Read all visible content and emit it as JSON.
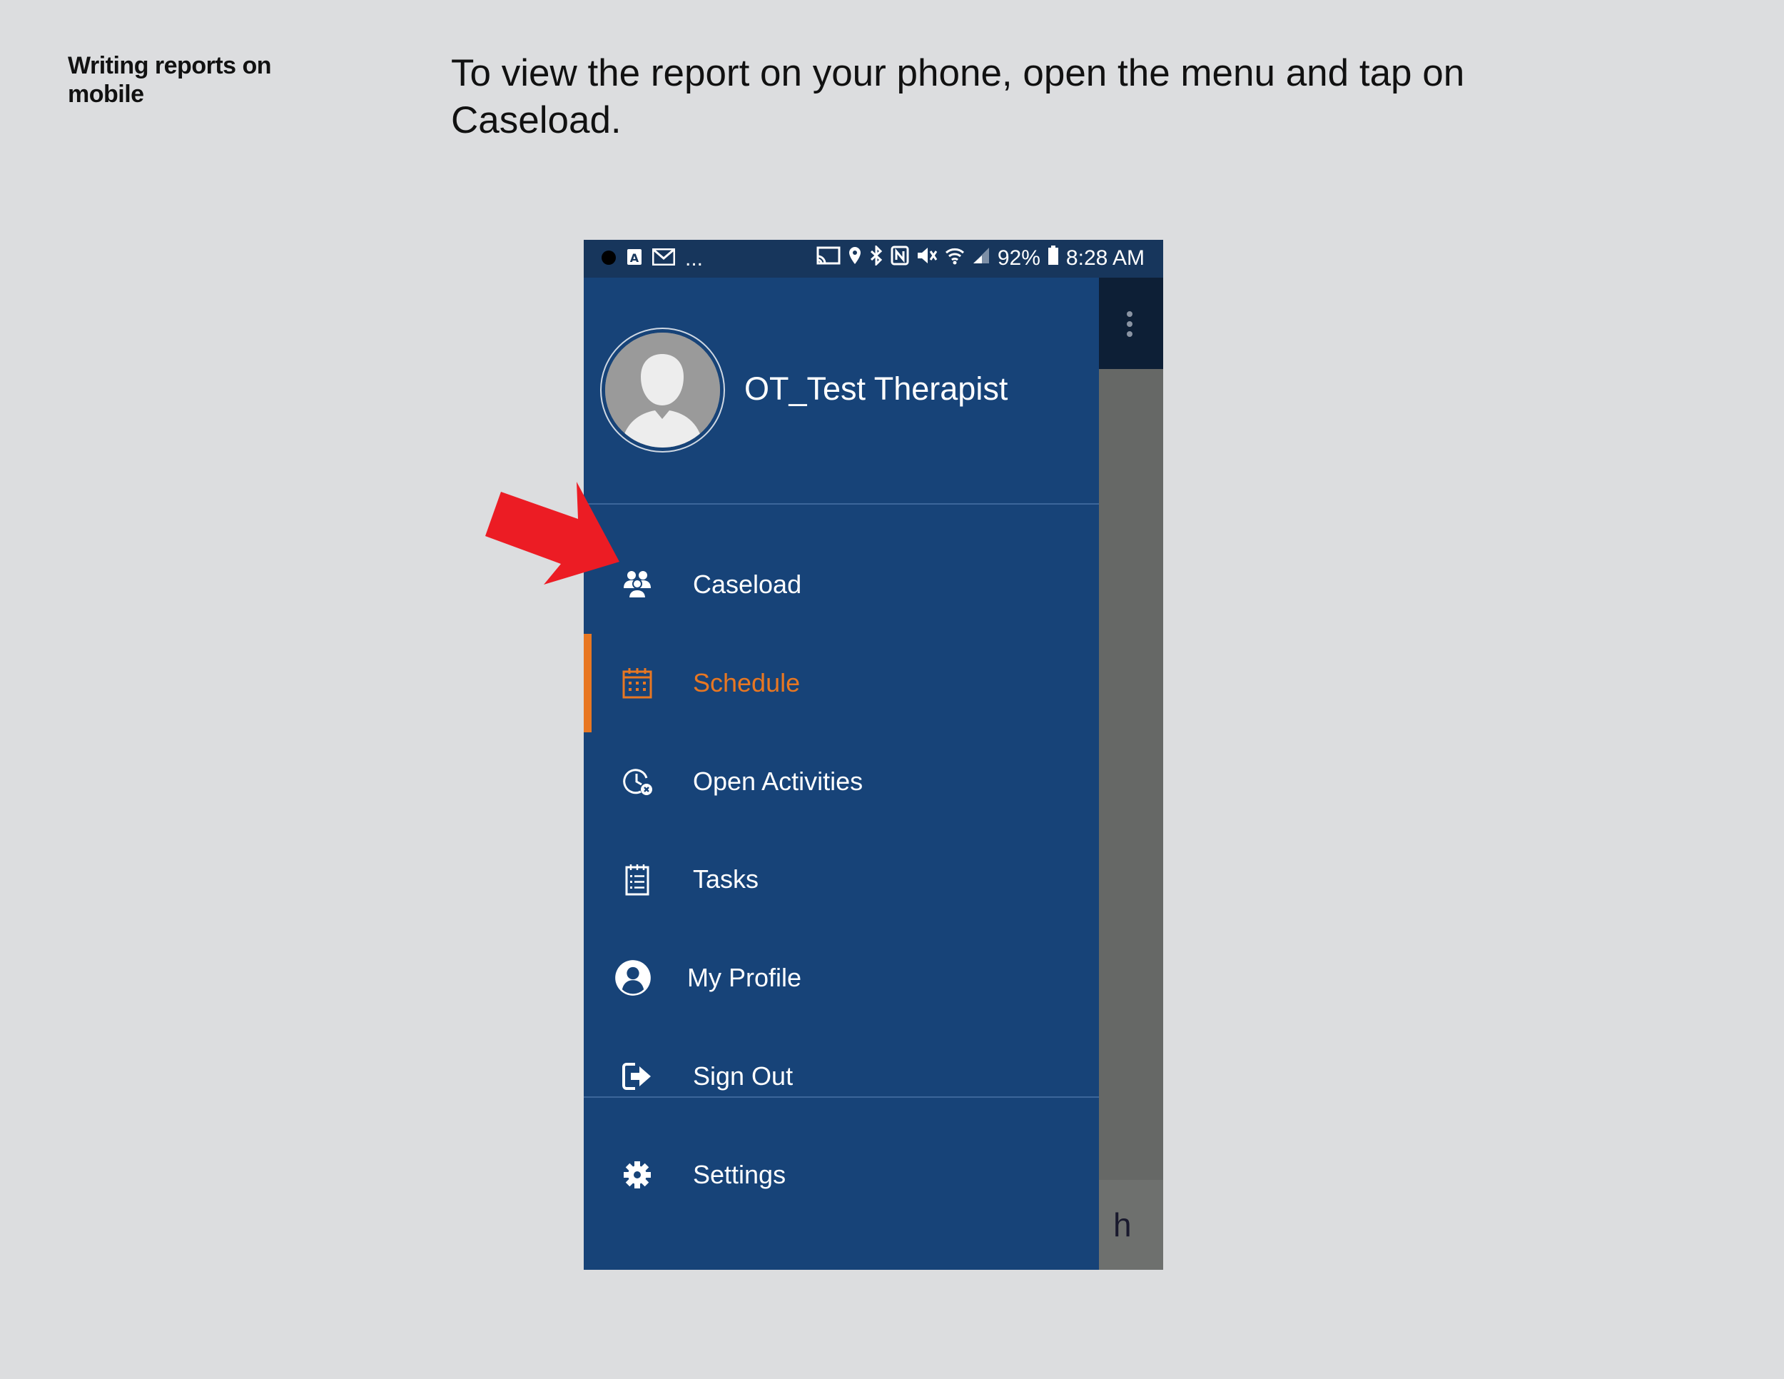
{
  "slide": {
    "title": "Writing reports on mobile",
    "instruction": "To view the report on your phone, open the menu and tap on Caseload."
  },
  "status_bar": {
    "left_text": "...",
    "battery": "92%",
    "time": "8:28 AM"
  },
  "drawer": {
    "user_name": "OT_Test Therapist",
    "items": [
      {
        "label": "Caseload",
        "icon": "people-icon"
      },
      {
        "label": "Schedule",
        "icon": "calendar-icon",
        "active": true
      },
      {
        "label": "Open Activities",
        "icon": "clock-icon"
      },
      {
        "label": "Tasks",
        "icon": "checklist-icon"
      },
      {
        "label": "My Profile",
        "icon": "user-circle-icon"
      },
      {
        "label": "Sign Out",
        "icon": "sign-out-icon"
      },
      {
        "label": "Settings",
        "icon": "gear-icon"
      }
    ]
  },
  "background": {
    "partial_text": "h"
  },
  "colors": {
    "drawer": "#174378",
    "status_bar": "#17365c",
    "accent": "#e87722",
    "arrow": "#ec1c24"
  }
}
